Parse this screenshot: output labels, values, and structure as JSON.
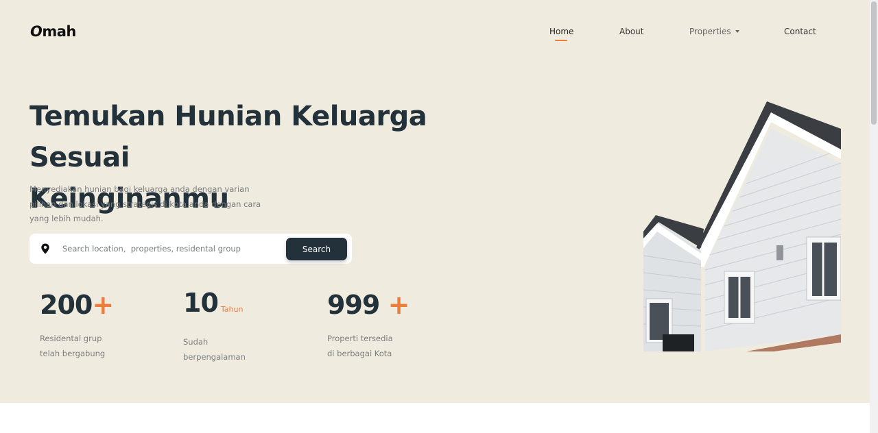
{
  "brand": {
    "logo_o": "O",
    "logo_rest": "mah"
  },
  "nav": {
    "home": "Home",
    "about": "About",
    "properties": "Properties",
    "contact": "Contact"
  },
  "hero": {
    "title_line1": "Temukan Hunian Keluarga Sesuai",
    "title_line2": "Keinginanmu",
    "desc_line1": "Menyediakan hunian bagi keluarga anda dengan varian",
    "desc_line2": "pilihan dan lokasi yang strategis di kota anda dengan cara",
    "desc_line3": "yang lebih mudah."
  },
  "search": {
    "placeholder": "Search location,  properties, residental group",
    "button_label": "Search",
    "icon": "map-pin-icon"
  },
  "stats": [
    {
      "number": "200",
      "suffix": "+",
      "label_line1": "Residental grup",
      "label_line2": "telah bergabung"
    },
    {
      "number": "10",
      "suffix": "Tahun",
      "label_line1": "Sudah",
      "label_line2": "berpengalaman"
    },
    {
      "number": "999",
      "suffix": "+",
      "label_line1": "Properti tersedia",
      "label_line2": "di berbagai Kota"
    }
  ],
  "colors": {
    "background": "#efebde",
    "primary": "#22313a",
    "accent": "#ee7d3c",
    "muted": "#7a7d7f"
  }
}
